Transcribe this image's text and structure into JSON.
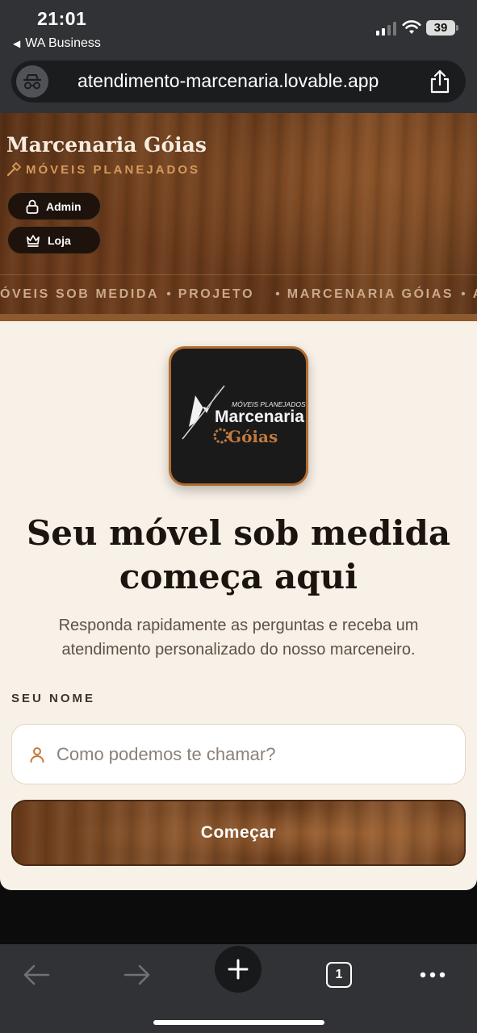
{
  "status_bar": {
    "time": "21:01",
    "back_app": "WA Business",
    "battery": "39"
  },
  "browser": {
    "url": "atendimento-marcenaria.lovable.app",
    "tab_count": "1"
  },
  "hero": {
    "brand": "Marcenaria Góias",
    "tagline": "MÓVEIS PLANEJADOS",
    "buttons": [
      {
        "label": "Admin",
        "icon": "lock-icon"
      },
      {
        "label": "Loja",
        "icon": "crown-icon"
      }
    ],
    "ticker": [
      "ÓVEIS SOB MEDIDA",
      "PROJETO",
      "MARCENARIA GÓIAS",
      "AC"
    ]
  },
  "logo": {
    "small_text": "MÓVEIS PLANEJADOS",
    "main_text": "Marcenaria",
    "sub_text": "Góias"
  },
  "main": {
    "headline_line1": "Seu móvel sob medida",
    "headline_line2": "começa aqui",
    "subtitle": "Responda rapidamente as perguntas e receba um atendimento personalizado do nosso marceneiro.",
    "name_label": "SEU NOME",
    "name_placeholder": "Como podemos te chamar?",
    "name_value": "",
    "start_button": "Começar"
  },
  "colors": {
    "accent": "#b06d33",
    "cream": "#f8f1e7",
    "wood_dark": "#5a3116"
  }
}
